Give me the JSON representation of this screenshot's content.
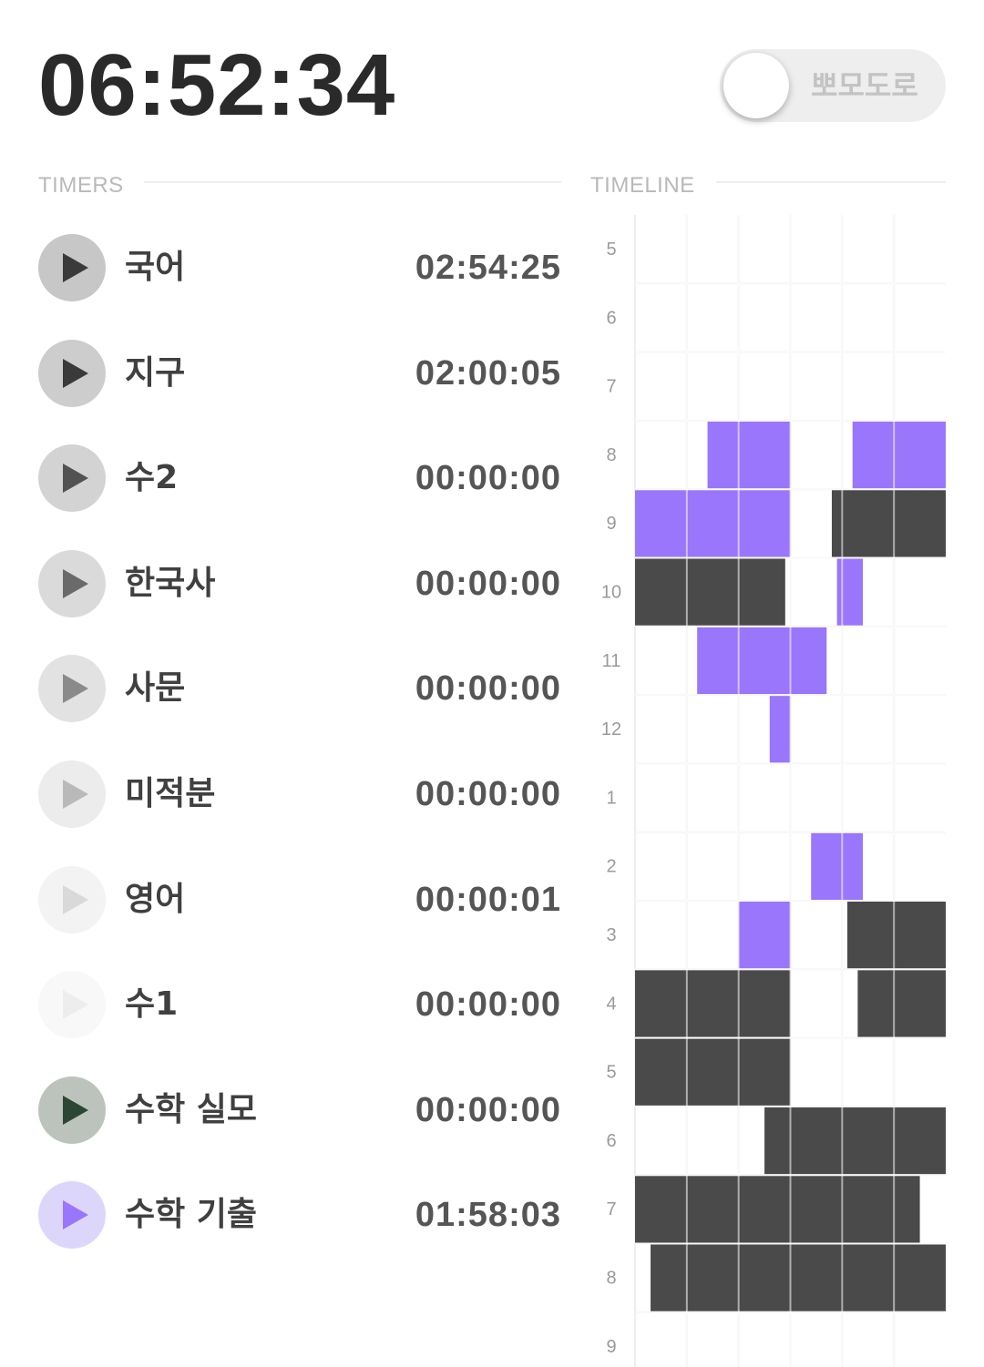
{
  "total_time": "06:52:34",
  "pomodoro_toggle": {
    "label": "뽀모도로",
    "enabled": false
  },
  "sections": {
    "timers": "TIMERS",
    "timeline": "TIMELINE"
  },
  "colors": {
    "study": "#9a76fc",
    "other": "#4a4a4b",
    "grid": "#eeeeee",
    "timeline_labels": "#9a9a9a"
  },
  "timers": [
    {
      "name": "국어",
      "time": "02:54:25",
      "button_bg": "#c7c7c7",
      "icon_color": "#3a3a3a"
    },
    {
      "name": "지구",
      "time": "02:00:05",
      "button_bg": "#cdcdcd",
      "icon_color": "#3a3a3a"
    },
    {
      "name": "수2",
      "time": "00:00:00",
      "button_bg": "#d3d3d3",
      "icon_color": "#525252"
    },
    {
      "name": "한국사",
      "time": "00:00:00",
      "button_bg": "#dadada",
      "icon_color": "#6a6a6a"
    },
    {
      "name": "사문",
      "time": "00:00:00",
      "button_bg": "#e2e2e2",
      "icon_color": "#8a8a8a"
    },
    {
      "name": "미적분",
      "time": "00:00:00",
      "button_bg": "#ececec",
      "icon_color": "#b9b9b9"
    },
    {
      "name": "영어",
      "time": "00:00:01",
      "button_bg": "#f3f3f3",
      "icon_color": "#d9d9d9"
    },
    {
      "name": "수1",
      "time": "00:00:00",
      "button_bg": "#f8f8f8",
      "icon_color": "#ededed"
    },
    {
      "name": "수학 실모",
      "time": "00:00:00",
      "button_bg": "#bcc3bd",
      "icon_color": "#2d4634"
    },
    {
      "name": "수학 기출",
      "time": "01:58:03",
      "button_bg": "#ddd6fb",
      "icon_color": "#9a76fc"
    }
  ],
  "timeline": {
    "hour_labels": [
      "5",
      "6",
      "7",
      "8",
      "9",
      "10",
      "11",
      "12",
      "1",
      "2",
      "3",
      "4",
      "5",
      "6",
      "7",
      "8",
      "9"
    ],
    "minutes_per_row": 60,
    "columns": 6,
    "blocks": [
      {
        "row": 3,
        "start_min": 14,
        "end_min": 30,
        "color": "study"
      },
      {
        "row": 3,
        "start_min": 42,
        "end_min": 60,
        "color": "study"
      },
      {
        "row": 4,
        "start_min": 0,
        "end_min": 30,
        "color": "study"
      },
      {
        "row": 4,
        "start_min": 38,
        "end_min": 60,
        "color": "other"
      },
      {
        "row": 5,
        "start_min": 0,
        "end_min": 29,
        "color": "other"
      },
      {
        "row": 5,
        "start_min": 39,
        "end_min": 44,
        "color": "study"
      },
      {
        "row": 6,
        "start_min": 12,
        "end_min": 37,
        "color": "study"
      },
      {
        "row": 7,
        "start_min": 26,
        "end_min": 30,
        "color": "study"
      },
      {
        "row": 9,
        "start_min": 34,
        "end_min": 44,
        "color": "study"
      },
      {
        "row": 10,
        "start_min": 20,
        "end_min": 30,
        "color": "study"
      },
      {
        "row": 10,
        "start_min": 41,
        "end_min": 60,
        "color": "other"
      },
      {
        "row": 11,
        "start_min": 0,
        "end_min": 30,
        "color": "other"
      },
      {
        "row": 11,
        "start_min": 43,
        "end_min": 60,
        "color": "other"
      },
      {
        "row": 12,
        "start_min": 0,
        "end_min": 30,
        "color": "other"
      },
      {
        "row": 13,
        "start_min": 25,
        "end_min": 60,
        "color": "other"
      },
      {
        "row": 14,
        "start_min": 0,
        "end_min": 55,
        "color": "other"
      },
      {
        "row": 15,
        "start_min": 3,
        "end_min": 60,
        "color": "other"
      }
    ]
  }
}
